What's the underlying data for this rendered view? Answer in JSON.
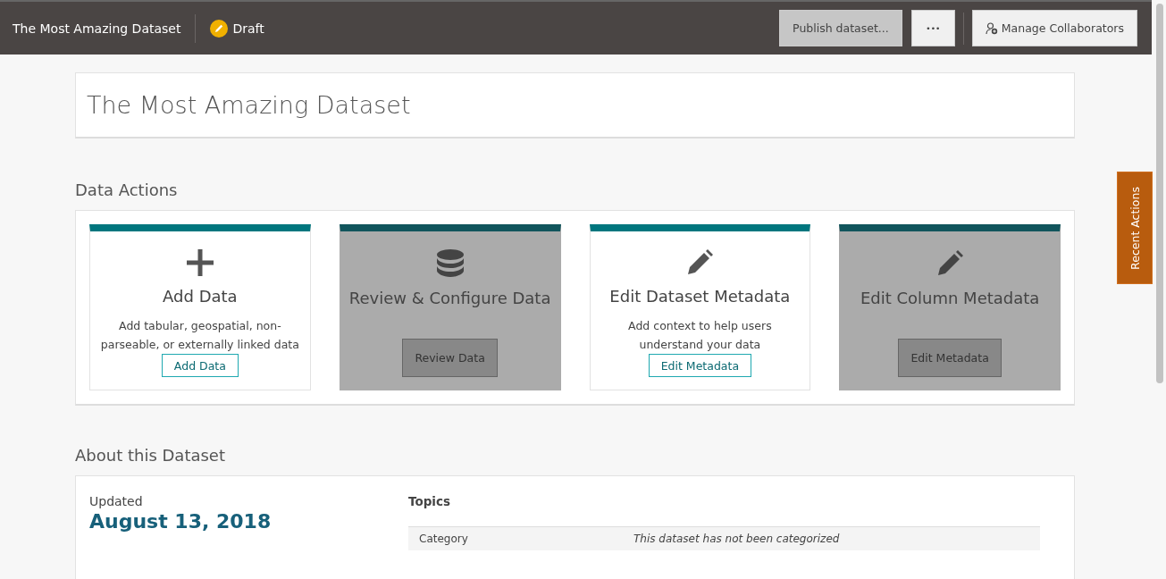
{
  "header": {
    "title": "The Most Amazing Dataset",
    "status": "Draft",
    "buttons": [
      {
        "label": "Publish dataset...",
        "disabled": true
      },
      {
        "label": "•••",
        "disabled": false
      },
      {
        "label": "Manage Collaborators",
        "disabled": false
      }
    ]
  },
  "dataset_title": "The Most Amazing Dataset",
  "data_actions": {
    "heading": "Data Actions",
    "cards": [
      {
        "title": "Add Data",
        "description": "Add tabular, geospatial, non-parseable, or externally linked data",
        "button": "Add Data",
        "disabled": false
      },
      {
        "title": "Review & Configure Data",
        "button": "Review Data",
        "disabled": true
      },
      {
        "title": "Edit Dataset Metadata",
        "description": "Add context to help users understand your data",
        "button": "Edit Metadata",
        "disabled": false
      },
      {
        "title": "Edit Column Metadata",
        "button": "Edit Metadata",
        "disabled": true
      }
    ]
  },
  "recent_actions": "Recent Actions",
  "about": {
    "heading": "About this Dataset",
    "updated_label": "Updated",
    "updated_date": "August 13, 2018",
    "topics_heading": "Topics",
    "rows": [
      {
        "label": "Category",
        "value": "This dataset has not been categorized"
      }
    ]
  }
}
